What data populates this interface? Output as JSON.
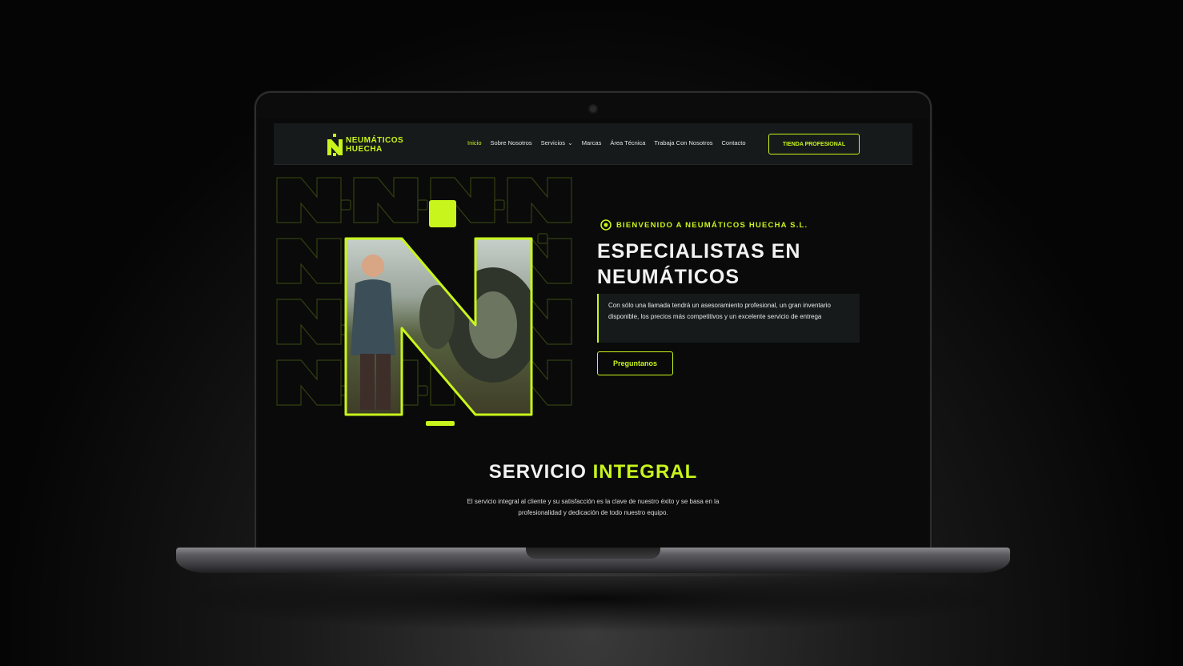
{
  "brand": {
    "line1": "NEUMÁTICOS",
    "line2": "HUECHA",
    "accent": "#c8f51c",
    "background": "#0a0a0a"
  },
  "nav": {
    "links": [
      {
        "label": "Inicio",
        "active": true
      },
      {
        "label": "Sobre Nosotros"
      },
      {
        "label": "Servicios",
        "dropdown": true
      },
      {
        "label": "Marcas"
      },
      {
        "label": "Área Técnica"
      },
      {
        "label": "Trabaja Con Nosotros"
      },
      {
        "label": "Contacto"
      }
    ],
    "cta": "TIENDA PROFESIONAL"
  },
  "hero": {
    "eyebrow": "BIENVENIDO A NEUMÁTICOS HUECHA S.L.",
    "title_line1": "ESPECIALISTAS EN",
    "title_line2": "NEUMÁTICOS",
    "description": "Con sólo una llamada tendrá un asesoramiento profesional, un gran inventario disponible, los precios más competitivos y un excelente servicio de entrega",
    "button": "Preguntanos",
    "image_icon": "n-shaped-photo-frame"
  },
  "section": {
    "title_plain": "SERVICIO ",
    "title_highlight": "INTEGRAL",
    "description": "El servicio integral al cliente y su satisfacción es la clave de nuestro éxito y se basa en la profesionalidad y dedicación de todo nuestro equipo."
  }
}
